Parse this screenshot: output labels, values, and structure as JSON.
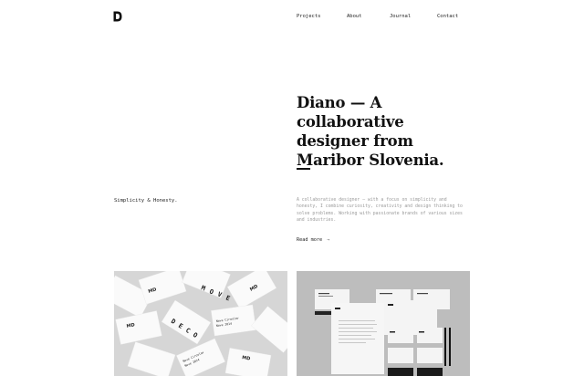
{
  "brand": {
    "logo_icon": "d-monogram-icon"
  },
  "nav": {
    "items": [
      "Projects",
      "About",
      "Journal",
      "Contact"
    ]
  },
  "hero": {
    "title": "Diano — A collaborative designer from Maribor Slovenia."
  },
  "tagline": "Simplicity & Honesty.",
  "description": "A collaborative designer — with a focus on simplicity and honesty, I combine curiosity, creativity and design thinking to solve problems. Working with passionate brands of various sizes and industries.",
  "read_more": {
    "label": "Read more",
    "arrow": "→"
  },
  "portfolio": {
    "card1_line1": "Nove Ciroslav",
    "card1_line2": "Nove 2014",
    "stamp": "MOVE DECO",
    "stamp_letters": [
      "M",
      "O",
      "V",
      "E",
      "D",
      "E",
      "C",
      "O"
    ]
  },
  "colors": {
    "text": "#111111",
    "muted": "#9a9a9a",
    "background": "#ffffff"
  }
}
